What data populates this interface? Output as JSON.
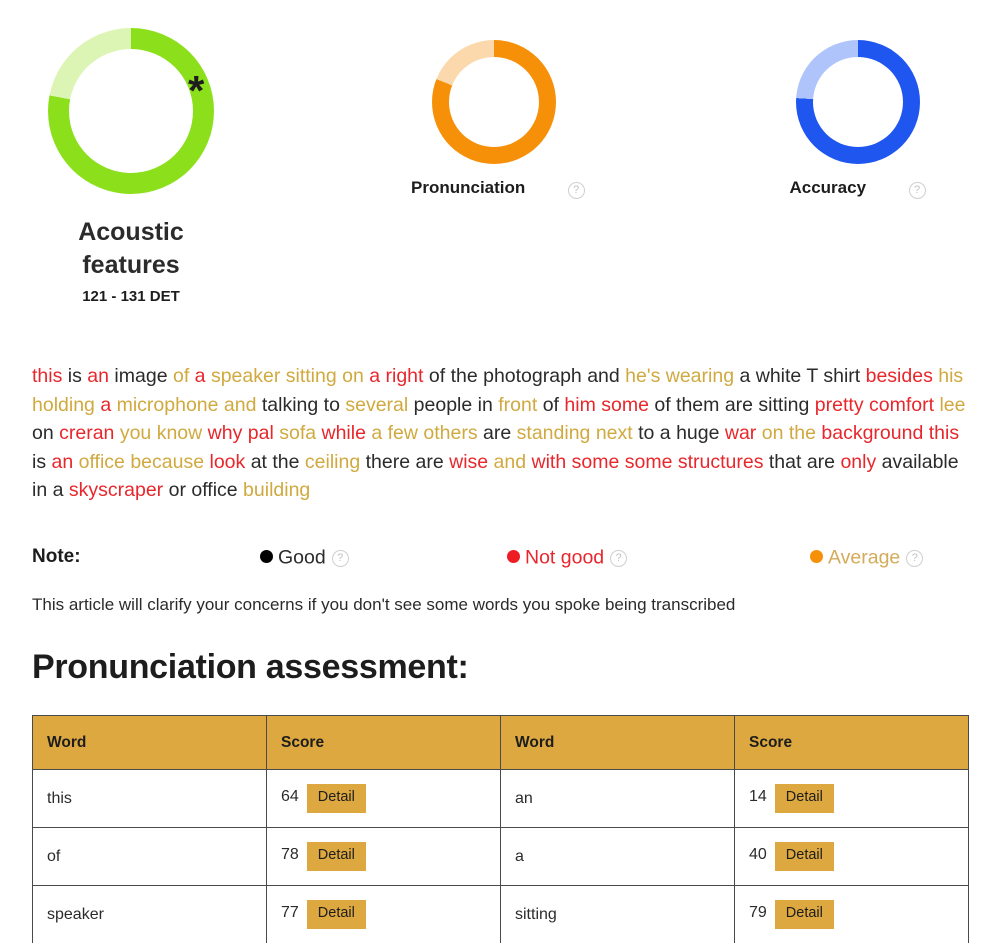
{
  "gauges": [
    {
      "id": "acoustic-features",
      "value": 78,
      "value_label": "78%",
      "title": "Acoustic features",
      "subtitle": "121 - 131 DET",
      "asterisk": "*",
      "color": "#8CE01B",
      "track_color": "#DDF5B4",
      "has_help": false
    },
    {
      "id": "pronunciation",
      "value": 81,
      "value_label": "81%",
      "title": "Pronunciation",
      "color": "#F79009",
      "track_color": "#FBD9AC",
      "has_help": true,
      "help_label": "?"
    },
    {
      "id": "accuracy",
      "value": 76,
      "value_label": "76%",
      "title": "Accuracy",
      "color": "#1F56F0",
      "track_color": "#AFC4FA",
      "has_help": true,
      "help_label": "?"
    }
  ],
  "transcript": {
    "tokens": [
      {
        "t": "this",
        "c": "bad"
      },
      {
        "t": "is",
        "c": "good"
      },
      {
        "t": "an",
        "c": "bad"
      },
      {
        "t": "image",
        "c": "good"
      },
      {
        "t": "of",
        "c": "avg"
      },
      {
        "t": "a",
        "c": "bad"
      },
      {
        "t": "speaker",
        "c": "avg"
      },
      {
        "t": "sitting",
        "c": "avg"
      },
      {
        "t": "on",
        "c": "avg"
      },
      {
        "t": "a",
        "c": "bad"
      },
      {
        "t": "right",
        "c": "bad"
      },
      {
        "t": "of",
        "c": "good"
      },
      {
        "t": "the",
        "c": "good"
      },
      {
        "t": "photograph",
        "c": "good"
      },
      {
        "t": "and",
        "c": "good"
      },
      {
        "t": "he's",
        "c": "avg"
      },
      {
        "t": "wearing",
        "c": "avg"
      },
      {
        "t": "a",
        "c": "good"
      },
      {
        "t": "white",
        "c": "good"
      },
      {
        "t": "T",
        "c": "good"
      },
      {
        "t": "shirt",
        "c": "good"
      },
      {
        "t": "besides",
        "c": "bad"
      },
      {
        "t": "his",
        "c": "avg"
      },
      {
        "t": "holding",
        "c": "avg"
      },
      {
        "t": "a",
        "c": "bad"
      },
      {
        "t": "microphone",
        "c": "avg"
      },
      {
        "t": "and",
        "c": "avg"
      },
      {
        "t": "talking",
        "c": "good"
      },
      {
        "t": "to",
        "c": "good"
      },
      {
        "t": "several",
        "c": "avg"
      },
      {
        "t": "people",
        "c": "good"
      },
      {
        "t": "in",
        "c": "good"
      },
      {
        "t": "front",
        "c": "avg"
      },
      {
        "t": "of",
        "c": "good"
      },
      {
        "t": "him",
        "c": "bad"
      },
      {
        "t": "some",
        "c": "bad"
      },
      {
        "t": "of",
        "c": "good"
      },
      {
        "t": "them",
        "c": "good"
      },
      {
        "t": "are",
        "c": "good"
      },
      {
        "t": "sitting",
        "c": "good"
      },
      {
        "t": "pretty",
        "c": "bad"
      },
      {
        "t": "comfort",
        "c": "bad"
      },
      {
        "t": "lee",
        "c": "avg"
      },
      {
        "t": "on",
        "c": "good"
      },
      {
        "t": "creran",
        "c": "bad"
      },
      {
        "t": "you",
        "c": "avg"
      },
      {
        "t": "know",
        "c": "avg"
      },
      {
        "t": "why",
        "c": "bad"
      },
      {
        "t": "pal",
        "c": "bad"
      },
      {
        "t": "sofa",
        "c": "avg"
      },
      {
        "t": "while",
        "c": "bad"
      },
      {
        "t": "a",
        "c": "avg"
      },
      {
        "t": "few",
        "c": "avg"
      },
      {
        "t": "others",
        "c": "avg"
      },
      {
        "t": "are",
        "c": "good"
      },
      {
        "t": "standing",
        "c": "avg"
      },
      {
        "t": "next",
        "c": "avg"
      },
      {
        "t": "to",
        "c": "good"
      },
      {
        "t": "a",
        "c": "good"
      },
      {
        "t": "huge",
        "c": "good"
      },
      {
        "t": "war",
        "c": "bad"
      },
      {
        "t": "on",
        "c": "avg"
      },
      {
        "t": "the",
        "c": "avg"
      },
      {
        "t": "background",
        "c": "bad"
      },
      {
        "t": "this",
        "c": "bad"
      },
      {
        "t": "is",
        "c": "good"
      },
      {
        "t": "an",
        "c": "bad"
      },
      {
        "t": "office",
        "c": "avg"
      },
      {
        "t": "because",
        "c": "avg"
      },
      {
        "t": "look",
        "c": "bad"
      },
      {
        "t": "at",
        "c": "good"
      },
      {
        "t": "the",
        "c": "good"
      },
      {
        "t": "ceiling",
        "c": "avg"
      },
      {
        "t": "there",
        "c": "good"
      },
      {
        "t": "are",
        "c": "good"
      },
      {
        "t": "wise",
        "c": "bad"
      },
      {
        "t": "and",
        "c": "avg"
      },
      {
        "t": "with",
        "c": "bad"
      },
      {
        "t": "some",
        "c": "bad"
      },
      {
        "t": "some",
        "c": "bad"
      },
      {
        "t": "structures",
        "c": "bad"
      },
      {
        "t": "that",
        "c": "good"
      },
      {
        "t": "are",
        "c": "good"
      },
      {
        "t": "only",
        "c": "bad"
      },
      {
        "t": "available",
        "c": "good"
      },
      {
        "t": "in",
        "c": "good"
      },
      {
        "t": "a",
        "c": "good"
      },
      {
        "t": "skyscraper",
        "c": "bad"
      },
      {
        "t": "or",
        "c": "good"
      },
      {
        "t": "office",
        "c": "good"
      },
      {
        "t": "building",
        "c": "avg"
      }
    ]
  },
  "note": {
    "label": "Note:",
    "items": [
      {
        "label": "Good",
        "dot_color": "#000000",
        "text_color": "#2b2b2b",
        "help_label": "?"
      },
      {
        "label": "Not good",
        "dot_color": "#ee1c25",
        "text_color": "#e8272c",
        "help_label": "?"
      },
      {
        "label": "Average",
        "dot_color": "#F79009",
        "text_color": "#d4ab5a",
        "help_label": "?"
      }
    ]
  },
  "subnote": "This article will clarify your concerns if you don't see some words you spoke being transcribed",
  "heading": "Pronunciation assessment:",
  "table": {
    "headers": [
      "Word",
      "Score",
      "Word",
      "Score"
    ],
    "detail_label": "Detail",
    "rows": [
      {
        "word_a": "this",
        "score_a": "64",
        "word_b": "an",
        "score_b": "14"
      },
      {
        "word_a": "of",
        "score_a": "78",
        "word_b": "a",
        "score_b": "40"
      },
      {
        "word_a": "speaker",
        "score_a": "77",
        "word_b": "sitting",
        "score_b": "79"
      }
    ]
  },
  "colors": {
    "header_bg": "#dca83f",
    "detail_bg": "#dca83f",
    "border": "#4a4a4a"
  }
}
